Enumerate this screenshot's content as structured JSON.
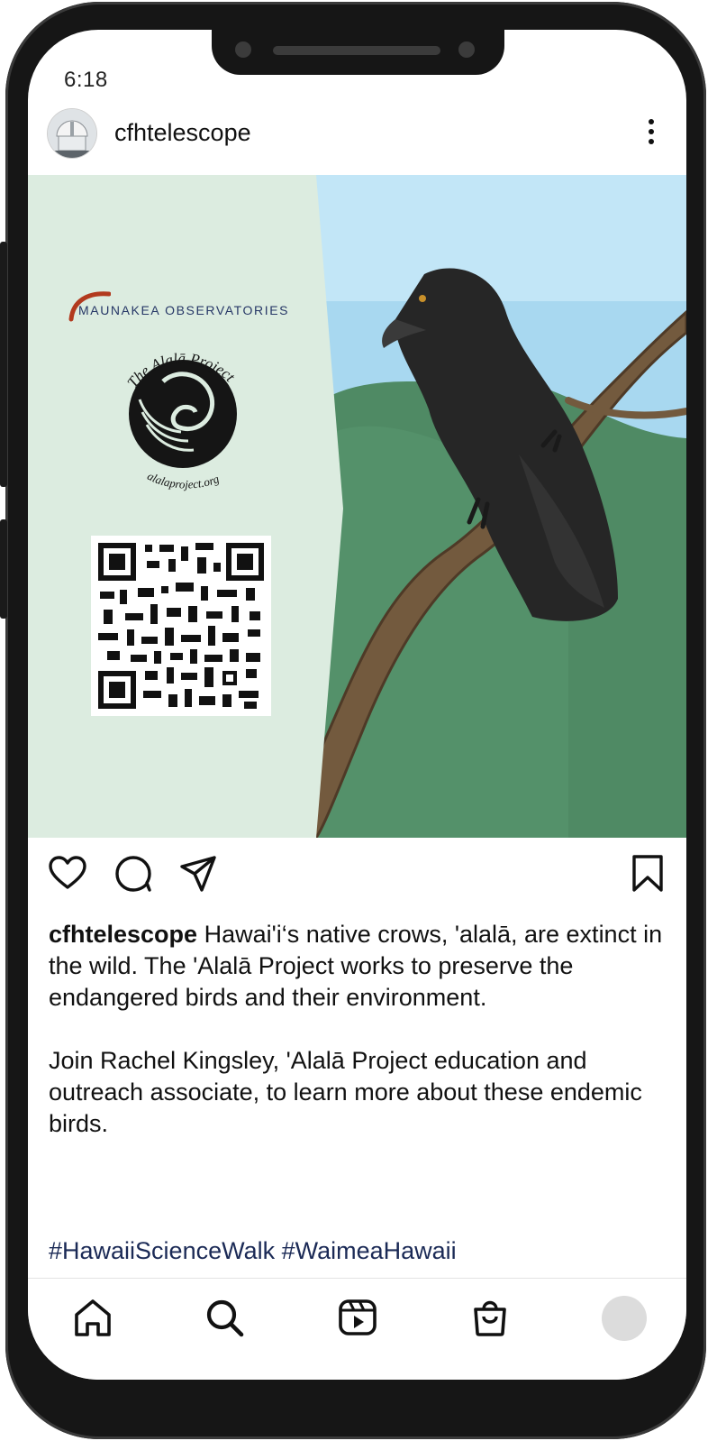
{
  "status_bar": {
    "time": "6:18"
  },
  "post": {
    "username": "cfhtelescope",
    "image": {
      "org_logo_text": "MAUNAKEA OBSERVATORIES",
      "project_logo_title": "The Alalā Project",
      "project_logo_url": "alalaproject.org"
    },
    "caption": {
      "username": "cfhtelescope",
      "text1": "Hawai'i‘s native crows, 'alalā, are extinct in the wild. The 'Alalā Project works to preserve the endangered birds and their environment.",
      "text2": "Join Rachel Kingsley, 'Alalā Project education and outreach associate, to learn more about these endemic birds.",
      "hashtags": "#HawaiiScienceWalk #WaimeaHawaii"
    }
  },
  "actions": [
    "heart-icon",
    "comment-icon",
    "share-icon",
    "bookmark-icon"
  ],
  "bottom_nav": [
    "home-icon",
    "search-icon",
    "reels-icon",
    "shop-icon",
    "profile-avatar"
  ],
  "colors": {
    "panel": "#dcece0",
    "sky": "#a8d8f0",
    "foliage": "#4f8a64",
    "branch": "#735a3e",
    "crow": "#262626",
    "hashtag": "#1b2a56",
    "org_blue": "#263766",
    "org_arc": "#b23a1e"
  }
}
